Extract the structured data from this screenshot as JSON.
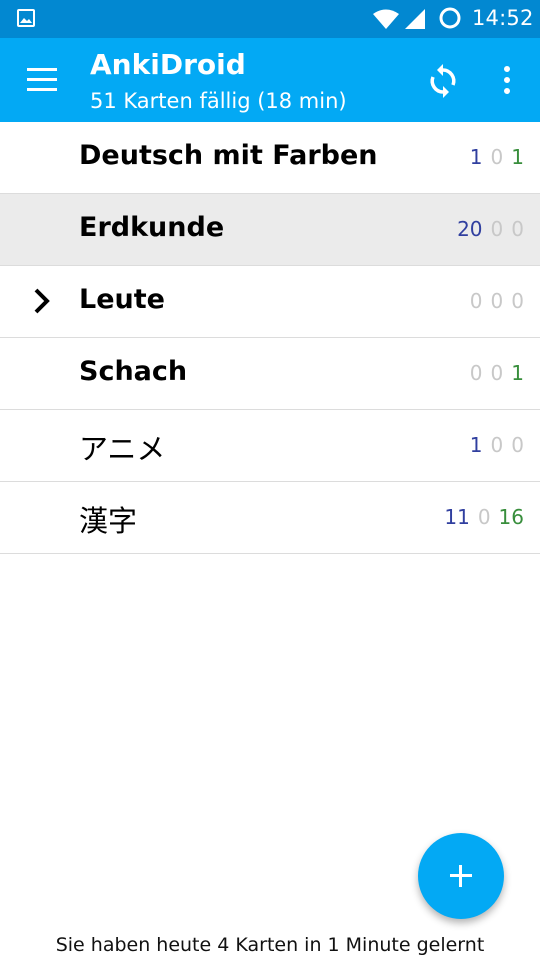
{
  "status_bar": {
    "time": "14:52",
    "icons": [
      "image-notification-icon",
      "wifi-icon",
      "signal-icon",
      "sync-ring-icon"
    ]
  },
  "app_bar": {
    "title": "AnkiDroid",
    "subtitle": "51 Karten fällig (18 min)",
    "background_color": "#03a9f4",
    "status_color": "#0288d1",
    "icons": [
      "menu-icon",
      "sync-icon",
      "overflow-menu-icon"
    ]
  },
  "decks": [
    {
      "name": "Deutsch mit Farben",
      "new": "1",
      "learn": "0",
      "review": "1",
      "selected": false,
      "expandable": false
    },
    {
      "name": "Erdkunde",
      "new": "20",
      "learn": "0",
      "review": "0",
      "selected": true,
      "expandable": false
    },
    {
      "name": "Leute",
      "new": "0",
      "learn": "0",
      "review": "0",
      "selected": false,
      "expandable": true
    },
    {
      "name": "Schach",
      "new": "0",
      "learn": "0",
      "review": "1",
      "selected": false,
      "expandable": false
    },
    {
      "name": "アニメ",
      "new": "1",
      "learn": "0",
      "review": "0",
      "selected": false,
      "expandable": false
    },
    {
      "name": "漢字",
      "new": "11",
      "learn": "0",
      "review": "16",
      "selected": false,
      "expandable": false
    }
  ],
  "count_colors": {
    "new": "#303f9f",
    "learn": "#c62828",
    "review": "#388e3c",
    "zero": "#c8c8c8"
  },
  "fab": {
    "icon": "plus-icon",
    "color": "#03a9f4"
  },
  "footer": {
    "text": "Sie haben heute 4 Karten in 1 Minute gelernt"
  }
}
